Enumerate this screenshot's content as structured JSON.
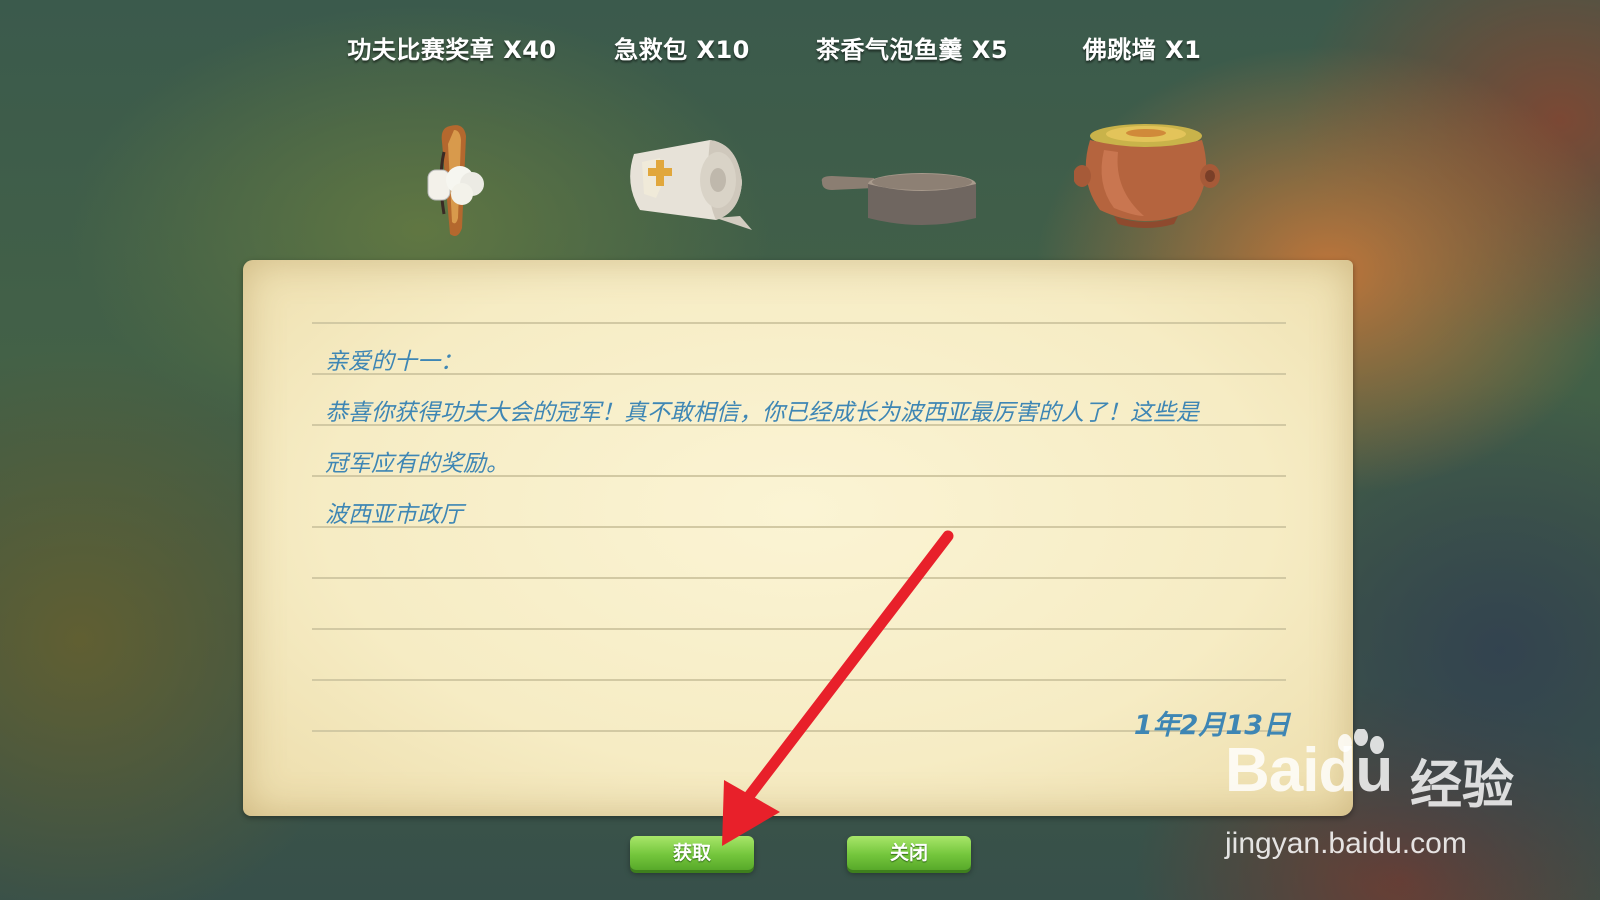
{
  "rewards": [
    {
      "label": "功夫比赛奖章 X40",
      "icon": "kungfu-medal-icon"
    },
    {
      "label": "急救包 X10",
      "icon": "first-aid-kit-icon"
    },
    {
      "label": "茶香气泡鱼羹 X5",
      "icon": "fish-soup-pan-icon"
    },
    {
      "label": "佛跳墙 X1",
      "icon": "clay-pot-icon"
    }
  ],
  "letter": {
    "greeting": "亲爱的十一：",
    "body_line1": "恭喜你获得功夫大会的冠军！真不敢相信，你已经成长为波西亚最厉害的人了！这些是",
    "body_line2": "冠军应有的奖励。",
    "signature": "波西亚市政厅",
    "date": "1年2月13日"
  },
  "buttons": {
    "claim": "获取",
    "close": "关闭"
  },
  "watermark": {
    "brand": "Baidu",
    "cn": "经验",
    "url": "jingyan.baidu.com"
  },
  "colors": {
    "letter_text": "#3e86b4",
    "button_green": "#74c63c",
    "annotation_arrow": "#e8202a"
  }
}
